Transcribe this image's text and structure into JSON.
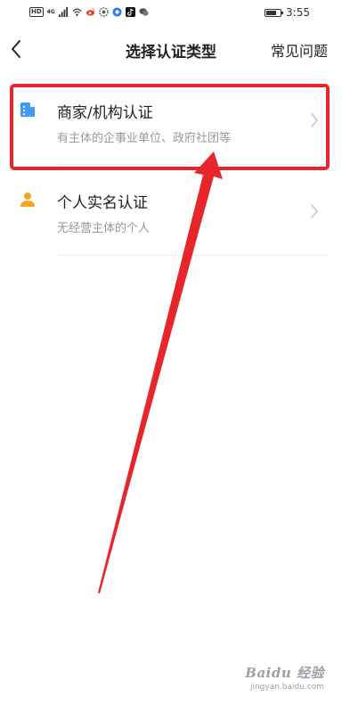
{
  "status_bar": {
    "network_badge": "HD",
    "network_type": "4G",
    "time": "3:55",
    "battery_level": 0.75
  },
  "nav": {
    "back_icon": "chevron-left-icon",
    "title": "选择认证类型",
    "faq_label": "常见问题"
  },
  "options": [
    {
      "icon": "building-icon",
      "title": "商家/机构认证",
      "subtitle": "有主体的企事业单位、政府社团等",
      "icon_color": "#3a9cf5"
    },
    {
      "icon": "person-icon",
      "title": "个人实名认证",
      "subtitle": "无经营主体的个人",
      "icon_color": "#f5a623"
    }
  ],
  "annotation_color": "#e8252a",
  "watermark": {
    "brand": "Baidu 经验",
    "url": "jingyan.baidu.com"
  }
}
